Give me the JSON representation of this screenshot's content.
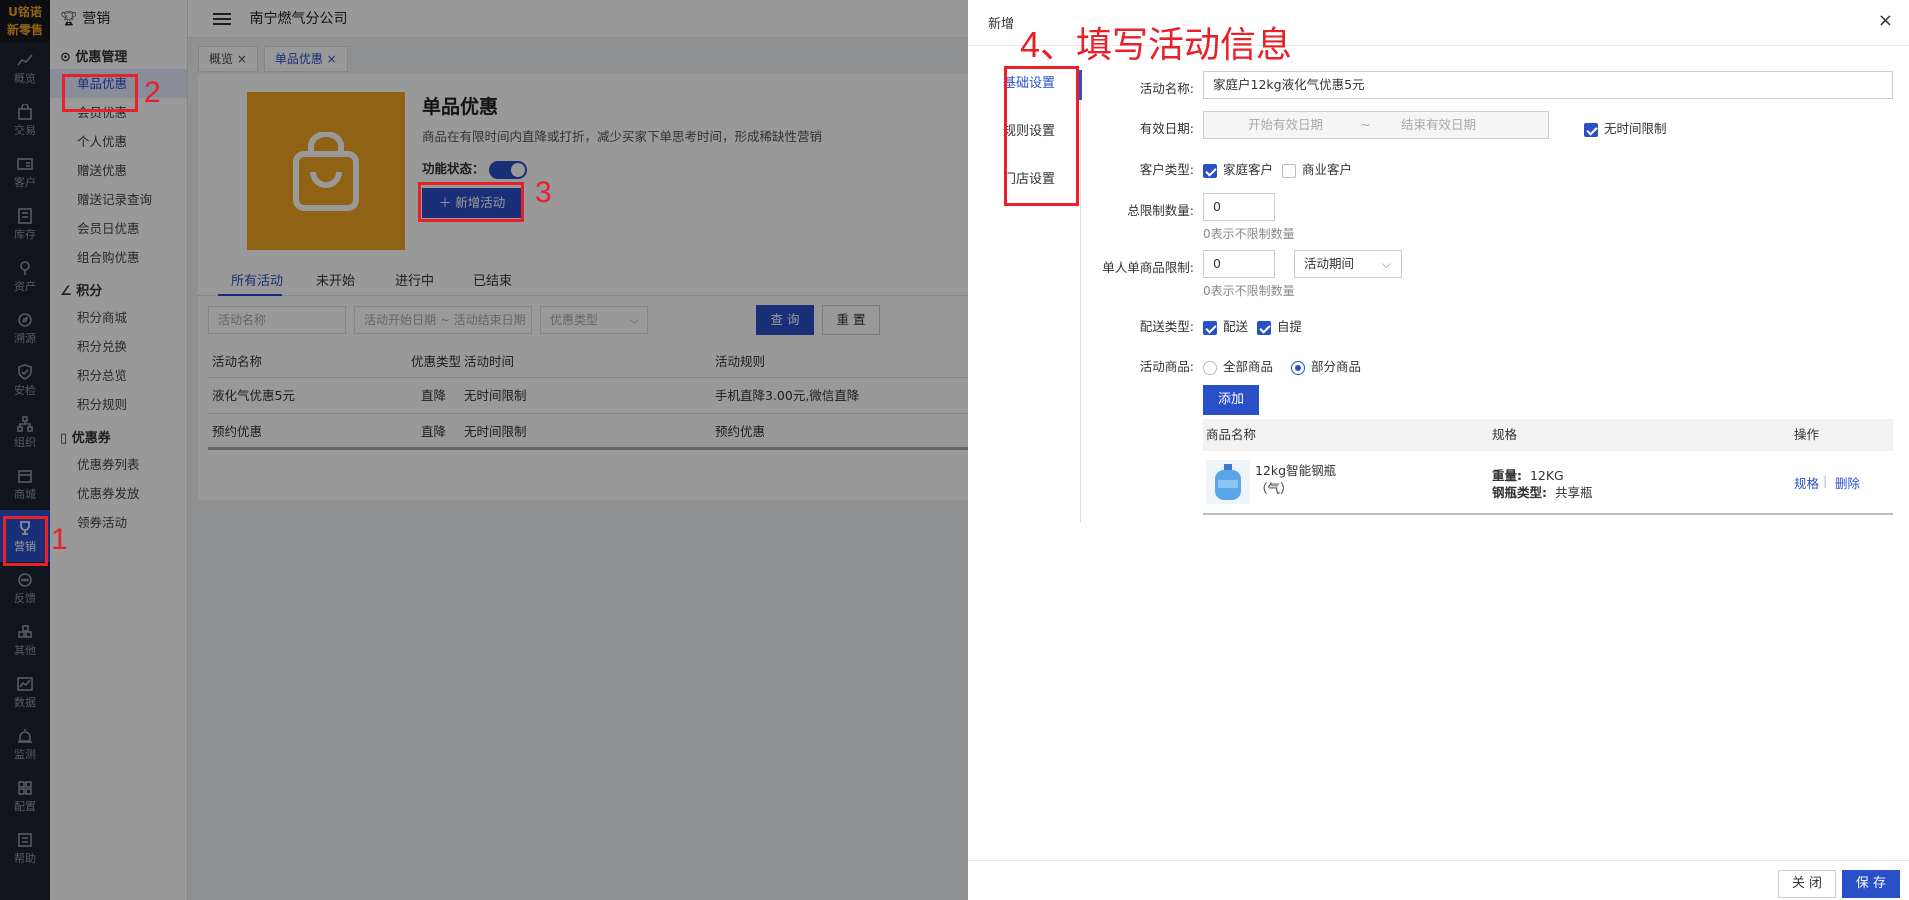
{
  "logo": {
    "line1": "U铭诺",
    "line2": "新零售"
  },
  "rail": [
    "概览",
    "交易",
    "客户",
    "库存",
    "资产",
    "溯源",
    "安检",
    "组织",
    "商城",
    "营销",
    "反馈",
    "其他",
    "数据",
    "监测",
    "配置",
    "帮助"
  ],
  "submenu": {
    "title": "营销",
    "groups": [
      {
        "title": "优惠管理",
        "items": [
          "单品优惠",
          "会员优惠",
          "个人优惠",
          "赠送优惠",
          "赠送记录查询",
          "会员日优惠",
          "组合购优惠"
        ]
      },
      {
        "title": "积分",
        "items": [
          "积分商城",
          "积分兑换",
          "积分总览",
          "积分规则"
        ]
      },
      {
        "title": "优惠券",
        "items": [
          "优惠券列表",
          "优惠券发放",
          "领券活动"
        ]
      }
    ]
  },
  "topbar": {
    "company": "南宁燃气分公司"
  },
  "tabs": [
    "概览 ×",
    "单品优惠 ×"
  ],
  "hero": {
    "title": "单品优惠",
    "desc": "商品在有限时间内直降或打折，减少买家下单思考时间，形成稀缺性营销",
    "status_label": "功能状态：",
    "add_button": "＋ 新增活动"
  },
  "subtabs": [
    "所有活动",
    "未开始",
    "进行中",
    "已结束"
  ],
  "filters": {
    "name_placeholder": "活动名称",
    "date_placeholder": "活动开始日期 ~ 活动结束日期",
    "type_placeholder": "优惠类型",
    "query": "查 询",
    "reset": "重 置"
  },
  "table": {
    "headers": [
      "活动名称",
      "优惠类型",
      "活动时间",
      "活动规则"
    ],
    "rows": [
      [
        "液化气优惠5元",
        "直降",
        "无时间限制",
        "手机直降3.00元,微信直降"
      ],
      [
        "预约优惠",
        "直降",
        "无时间限制",
        "预约优惠"
      ]
    ]
  },
  "annotations": {
    "n1": "1",
    "n2": "2",
    "n3": "3",
    "n4": "4、填写活动信息"
  },
  "drawer": {
    "title": "新增",
    "close_icon": "×",
    "nav": [
      "基础设置",
      "规则设置",
      "门店设置"
    ],
    "form": {
      "name_label": "活动名称:",
      "name_value": "家庭户12kg液化气优惠5元",
      "date_label": "有效日期:",
      "date_start": "开始有效日期",
      "date_sep": "~",
      "date_end": "结束有效日期",
      "no_limit": "无时间限制",
      "customer_label": "客户类型:",
      "customer_home": "家庭客户",
      "customer_biz": "商业客户",
      "total_label": "总限制数量:",
      "total_value": "0",
      "total_hint": "0表示不限制数量",
      "single_label": "单人单商品限制:",
      "single_value": "0",
      "single_period": "活动期间",
      "single_hint": "0表示不限制数量",
      "delivery_label": "配送类型:",
      "delivery_a": "配送",
      "delivery_b": "自提",
      "goods_label": "活动商品:",
      "goods_all": "全部商品",
      "goods_part": "部分商品",
      "add_button": "添加"
    },
    "goods_table": {
      "headers": [
        "商品名称",
        "规格",
        "操作"
      ],
      "row": {
        "name1": "12kg智能钢瓶",
        "name2": "（气）",
        "weight_label": "重量:",
        "weight_value": "12KG",
        "type_label": "钢瓶类型:",
        "type_value": "共享瓶",
        "op_spec": "规格",
        "op_sep": "|",
        "op_delete": "删除"
      }
    },
    "footer": {
      "close": "关 闭",
      "save": "保 存"
    }
  },
  "colors": {
    "accent": "#2a50c8",
    "annotation": "#e8202a",
    "brand": "#f0a321"
  }
}
